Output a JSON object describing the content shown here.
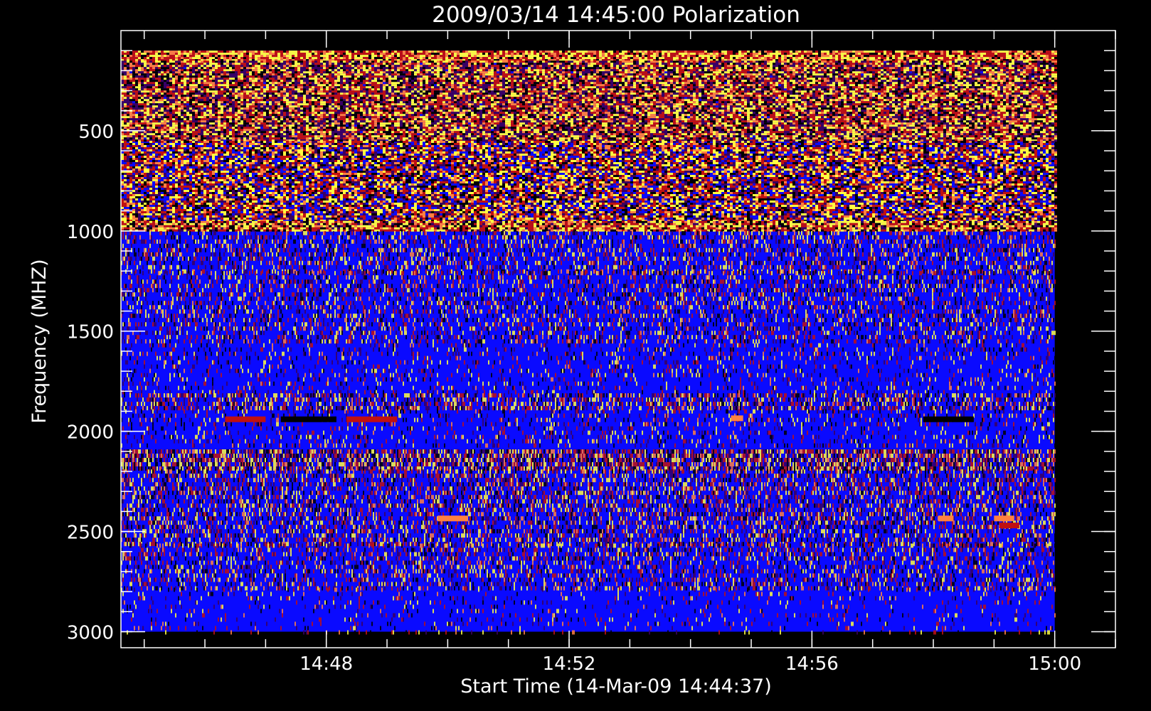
{
  "chart_data": {
    "type": "heatmap",
    "title": "2009/03/14 14:45:00 Polarization",
    "xlabel": "Start Time (14-Mar-09 14:44:37)",
    "ylabel": "Frequency (MHZ)",
    "x_start": "14:44:37",
    "x_end": "15:00:00",
    "xlim": [
      "14:44:37",
      "15:01:00"
    ],
    "x_ticks": [
      "14:48",
      "14:52",
      "14:56",
      "15:00"
    ],
    "x_minor_tick_step_min": 1,
    "ylim": [
      3080,
      0
    ],
    "y_data_range": [
      100,
      3000
    ],
    "y_ticks": [
      500,
      1000,
      1500,
      2000,
      2500,
      3000
    ],
    "y_minor_tick_step": 100,
    "y_inverted": true,
    "colormap": [
      "#000000",
      "#3a0060",
      "#0a0aff",
      "#c01010",
      "#ff8040",
      "#ffff40"
    ],
    "background": "#0a0aff",
    "bands": [
      {
        "from": 100,
        "to": 150,
        "pattern": "noise",
        "intensity": 0.92
      },
      {
        "from": 150,
        "to": 550,
        "pattern": "noise",
        "intensity": 0.62
      },
      {
        "from": 550,
        "to": 950,
        "pattern": "noise",
        "intensity": 0.5
      },
      {
        "from": 950,
        "to": 1000,
        "pattern": "noise",
        "intensity": 0.75
      },
      {
        "from": 1000,
        "to": 1200,
        "pattern": "streaks",
        "intensity": 0.42
      },
      {
        "from": 1200,
        "to": 1560,
        "pattern": "streaks",
        "intensity": 0.38
      },
      {
        "from": 1560,
        "to": 1800,
        "pattern": "streaks",
        "intensity": 0.2
      },
      {
        "from": 1810,
        "to": 1890,
        "pattern": "streaks",
        "intensity": 0.6
      },
      {
        "from": 1890,
        "to": 2080,
        "pattern": "streaks",
        "intensity": 0.22
      },
      {
        "from": 2090,
        "to": 2190,
        "pattern": "streaks",
        "intensity": 0.85
      },
      {
        "from": 2190,
        "to": 2560,
        "pattern": "streaks",
        "intensity": 0.5
      },
      {
        "from": 2560,
        "to": 2780,
        "pattern": "streaks",
        "intensity": 0.4
      },
      {
        "from": 2780,
        "to": 3000,
        "pattern": "streaks",
        "intensity": 0.12
      }
    ],
    "features": [
      {
        "freq": 1940,
        "t_from": "14:46:20",
        "t_to": "14:47:00",
        "color": "#c01010"
      },
      {
        "freq": 1940,
        "t_from": "14:47:15",
        "t_to": "14:48:10",
        "color": "#000000"
      },
      {
        "freq": 1940,
        "t_from": "14:48:20",
        "t_to": "14:49:10",
        "color": "#c01010"
      },
      {
        "freq": 1935,
        "t_from": "14:54:40",
        "t_to": "14:54:52",
        "color": "#ff8040"
      },
      {
        "freq": 1940,
        "t_from": "14:57:50",
        "t_to": "14:58:40",
        "color": "#000000"
      },
      {
        "freq": 2435,
        "t_from": "14:49:50",
        "t_to": "14:50:20",
        "color": "#ff8040"
      },
      {
        "freq": 2435,
        "t_from": "14:58:05",
        "t_to": "14:58:20",
        "color": "#ff8040"
      },
      {
        "freq": 2435,
        "t_from": "14:59:00",
        "t_to": "14:59:20",
        "color": "#ff8040"
      },
      {
        "freq": 2470,
        "t_from": "14:59:05",
        "t_to": "14:59:25",
        "color": "#c01010"
      }
    ]
  }
}
